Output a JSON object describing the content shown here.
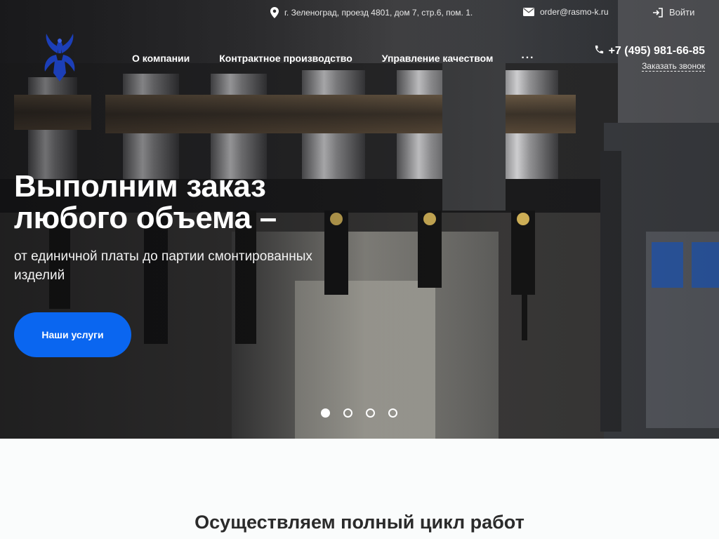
{
  "topbar": {
    "address": "г. Зеленоград, проезд 4801, дом 7, стр.6, пом. 1.",
    "email": "order@rasmo-k.ru",
    "login": "Войти"
  },
  "nav": {
    "items": [
      {
        "label": "О компании"
      },
      {
        "label": "Контрактное производство"
      },
      {
        "label": "Управление качеством"
      }
    ],
    "more": "···"
  },
  "contact": {
    "phone": "+7 (495) 981-66-85",
    "callback": "Заказать звонок"
  },
  "hero": {
    "headline_line1": "Выполним заказ",
    "headline_line2": "любого объема –",
    "subline": "от единичной платы до партии смонтированных изделий",
    "cta": "Наши услуги",
    "slides_total": 4,
    "active_slide": 1
  },
  "section": {
    "title": "Осуществляем полный цикл работ"
  },
  "colors": {
    "accent": "#0a66f0",
    "hero_bg": "#3a3a3c",
    "section_bg": "#fafcfc",
    "title_text": "#2b2b2b"
  },
  "icons": {
    "address": "map-pin-icon",
    "email": "envelope-icon",
    "login": "sign-in-icon",
    "phone": "phone-icon",
    "logo": "eagle-logo"
  }
}
